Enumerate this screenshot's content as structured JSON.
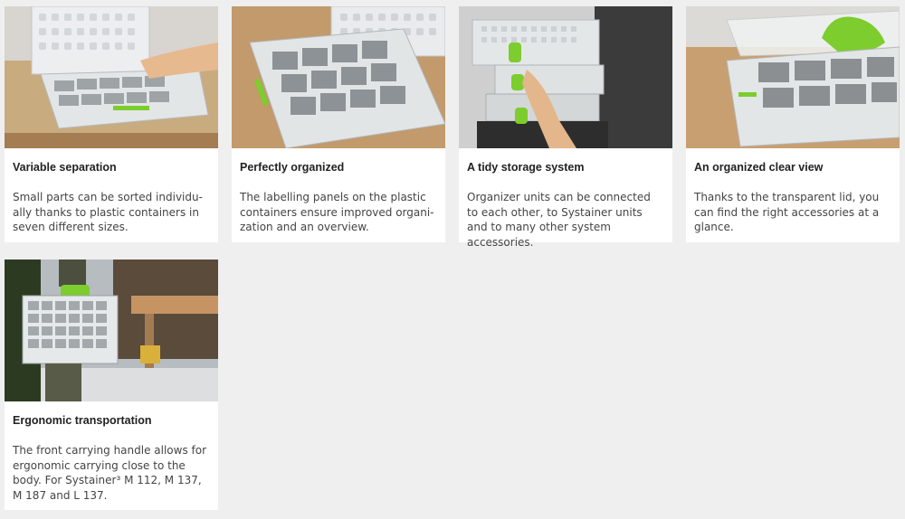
{
  "cards": [
    {
      "title": "Variable separation",
      "text": "Small parts can be sorted individu-ally thanks to plastic containers in seven different sizes."
    },
    {
      "title": "Perfectly organized",
      "text": "The labelling panels on the plastic containers ensure improved organi-zation and an overview."
    },
    {
      "title": "A tidy storage system",
      "text": "Organizer units can be connected to each other, to Systainer units and to many other system accessories."
    },
    {
      "title": "An organized clear view",
      "text": "Thanks to the transparent lid, you can find the right accessories at a glance."
    },
    {
      "title": "Ergonomic transportation",
      "text": "The front carrying handle allows for ergonomic carrying close to the body. For Systainer³ M 112, M 137, M 187 and L 137."
    }
  ],
  "colors": {
    "accent_green": "#7ccd2d",
    "wood": "#b98d5c",
    "box_grey": "#d9dcdc",
    "background": "#efefef"
  }
}
